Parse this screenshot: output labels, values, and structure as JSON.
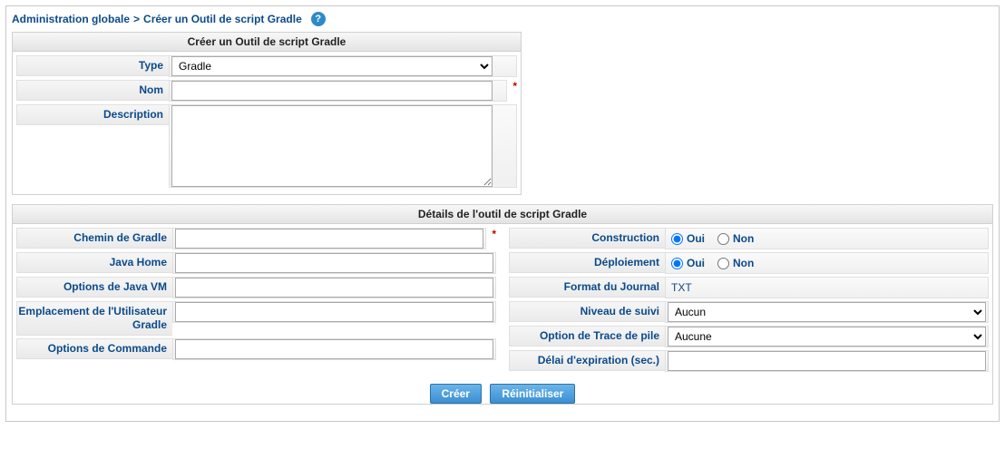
{
  "breadcrumb": {
    "root": "Administration globale",
    "sep": ">",
    "current": "Créer un Outil de script Gradle"
  },
  "panel1": {
    "title": "Créer un Outil de script Gradle",
    "type_label": "Type",
    "type_value": "Gradle",
    "nom_label": "Nom",
    "nom_value": "",
    "desc_label": "Description",
    "desc_value": ""
  },
  "panel2": {
    "title": "Détails de l'outil de script Gradle",
    "left": {
      "chemin_label": "Chemin de Gradle",
      "chemin_value": "",
      "javahome_label": "Java Home",
      "javahome_value": "",
      "jvmopts_label": "Options de Java VM",
      "jvmopts_value": "",
      "userloc_label": "Emplacement de l'Utilisateur Gradle",
      "userloc_value": "",
      "cmdopts_label": "Options de Commande",
      "cmdopts_value": ""
    },
    "right": {
      "construction_label": "Construction",
      "deploiement_label": "Déploiement",
      "oui": "Oui",
      "non": "Non",
      "journal_label": "Format du Journal",
      "journal_value": "TXT",
      "niveau_label": "Niveau de suivi",
      "niveau_value": "Aucun",
      "trace_label": "Option de Trace de pile",
      "trace_value": "Aucune",
      "delai_label": "Délai d'expiration (sec.)",
      "delai_value": ""
    }
  },
  "buttons": {
    "create": "Créer",
    "reset": "Réinitialiser"
  }
}
